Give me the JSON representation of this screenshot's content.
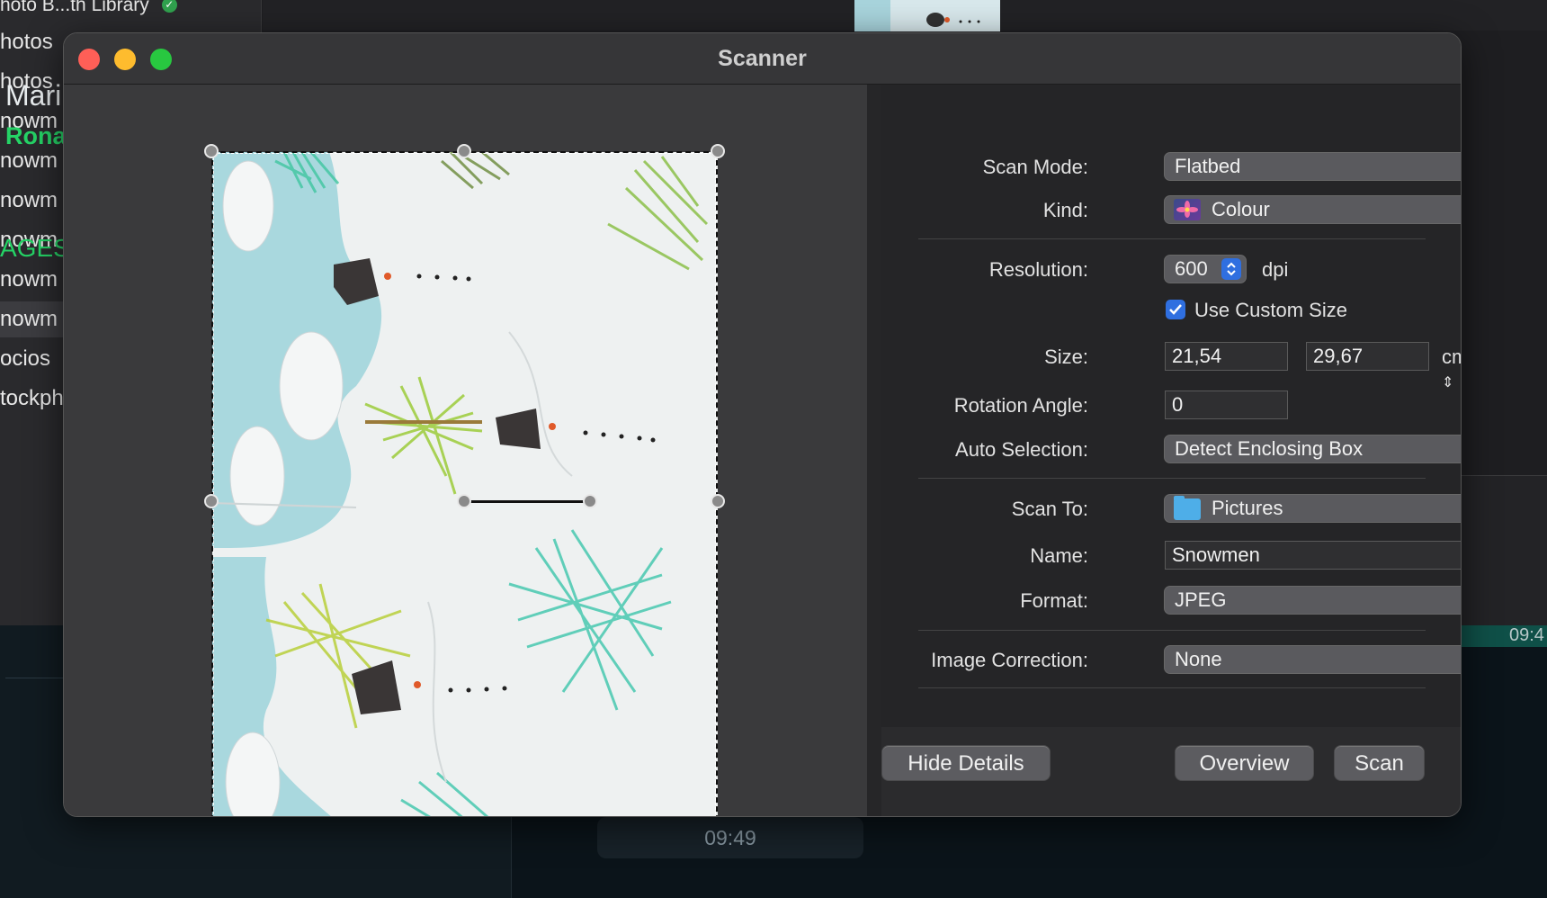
{
  "background": {
    "library_title": "hoto B...th Library",
    "sidebar_items": [
      "hotos",
      "hotos",
      "nowm",
      "nowm",
      "nowm",
      "nowm",
      "nowm",
      "nowm",
      "ocios",
      "tockph"
    ],
    "selected_index": 7,
    "chat_name": "Mari",
    "chat_sub": "Rona",
    "section": "AGES",
    "time_bubble": "09:49",
    "right_time": "09:4"
  },
  "window": {
    "title": "Scanner"
  },
  "details": {
    "scan_mode": {
      "label": "Scan Mode:",
      "value": "Flatbed"
    },
    "kind": {
      "label": "Kind:",
      "value": "Colour",
      "icon": "colour-flower-icon"
    },
    "resolution": {
      "label": "Resolution:",
      "value": "600",
      "unit": "dpi"
    },
    "custom_size": {
      "label": "Use Custom Size",
      "checked": true
    },
    "size": {
      "label": "Size:",
      "width": "21,54",
      "height": "29,67",
      "unit": "cm"
    },
    "rotation": {
      "label": "Rotation Angle:",
      "value": "0"
    },
    "auto_selection": {
      "label": "Auto Selection:",
      "value": "Detect Enclosing Box"
    },
    "scan_to": {
      "label": "Scan To:",
      "value": "Pictures",
      "icon": "pictures-folder-icon"
    },
    "name": {
      "label": "Name:",
      "value": "Snowmen"
    },
    "format": {
      "label": "Format:",
      "value": "JPEG"
    },
    "image_correction": {
      "label": "Image Correction:",
      "value": "None"
    }
  },
  "buttons": {
    "hide_details": "Hide Details",
    "overview": "Overview",
    "scan": "Scan"
  },
  "colors": {
    "accent": "#2f6fe0",
    "close": "#fe5f57",
    "minimize": "#febc2e",
    "maximize": "#28c840",
    "whatsapp_green": "#25d366"
  }
}
